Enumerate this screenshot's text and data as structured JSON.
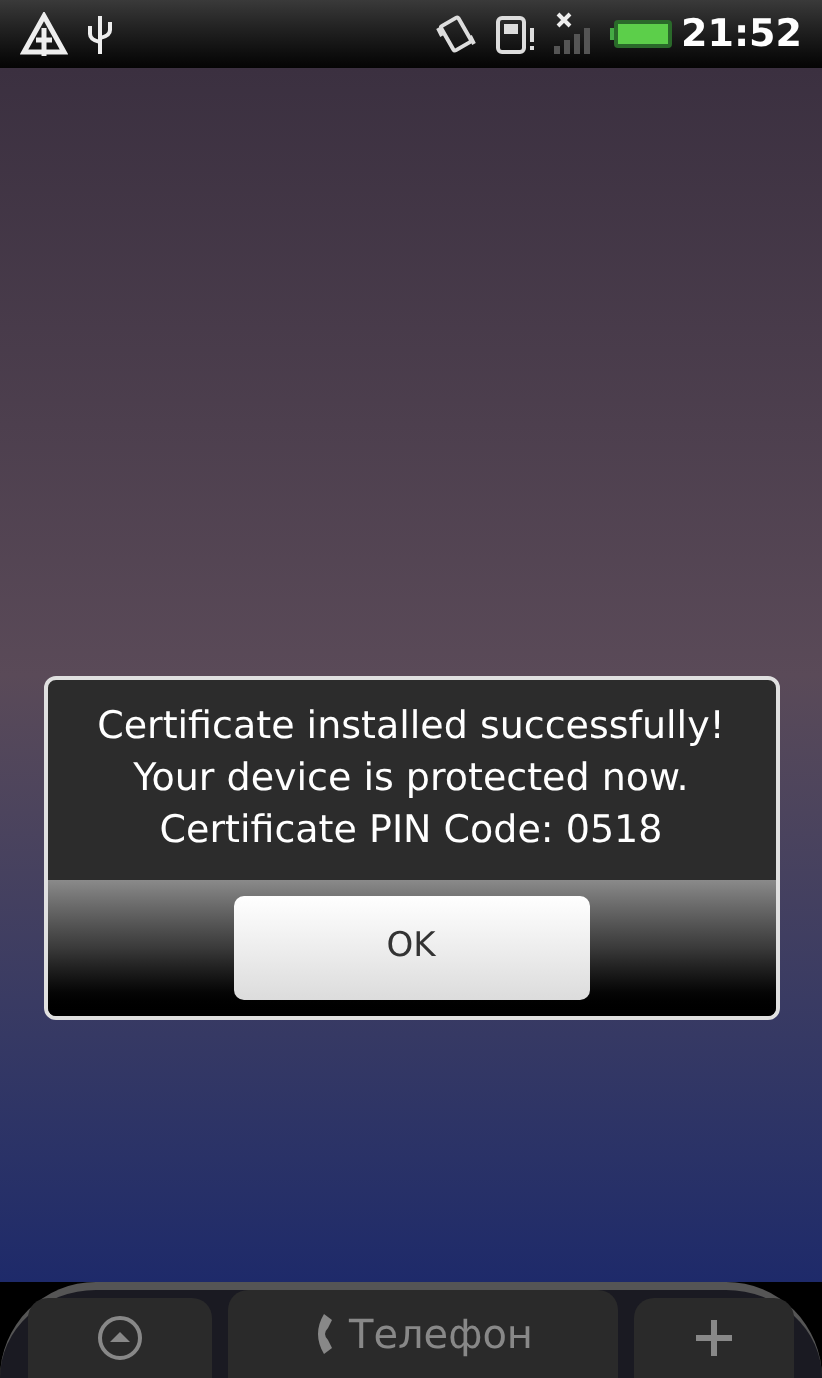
{
  "status_bar": {
    "time": "21:52"
  },
  "dialog": {
    "message_lines": [
      "Certificate installed successfully!",
      "Your device is protected now.",
      "Certificate PIN Code: 0518"
    ],
    "buttons": [
      "OK"
    ]
  },
  "dock": {
    "phone_label": "Телефон"
  }
}
